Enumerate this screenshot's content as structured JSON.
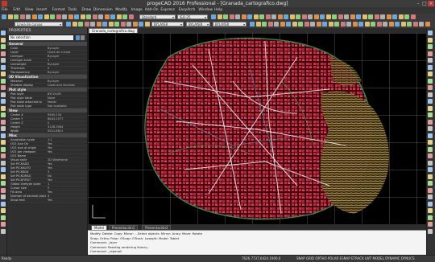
{
  "title": "progeCAD 2016 Professional - [Granada_cartografico.dwg]",
  "menu": [
    "File",
    "Edit",
    "View",
    "Insert",
    "Format",
    "Tools",
    "Draw",
    "Dimension",
    "Modify",
    "Image",
    "Add-On",
    "Express",
    "EasyArch",
    "Window",
    "Help"
  ],
  "toolbar": {
    "style_combo": "Standard",
    "dimstyle_combo": "ISO-25",
    "layer_combo": "Linea de curvas",
    "color_combo": "BYLAYER",
    "linetype_combo": "BYLAYER",
    "lineweight_combo": "BYLAYER"
  },
  "properties": {
    "header": "PROPERTIES",
    "selection": "No selection",
    "sections": {
      "general": "General",
      "viz3d": "3D Visualization",
      "plot": "Plot style",
      "view": "View",
      "misc": "Misc"
    },
    "general_rows": [
      {
        "k": "Color",
        "v": "ByLayer"
      },
      {
        "k": "Layer",
        "v": "Linea de curvas"
      },
      {
        "k": "Linetype",
        "v": "ByLayer"
      },
      {
        "k": "Linetype scale",
        "v": "1"
      },
      {
        "k": "Lineweight",
        "v": "ByLayer"
      },
      {
        "k": "Thickness",
        "v": "0"
      },
      {
        "k": "Transparency",
        "v": "ByLayer"
      }
    ],
    "viz3d_rows": [
      {
        "k": "Material",
        "v": "ByLayer"
      },
      {
        "k": "Shadow display",
        "v": "Casts and receives"
      }
    ],
    "plot_rows": [
      {
        "k": "Plot style",
        "v": "BYCOLOR"
      },
      {
        "k": "Plot style table",
        "v": "None"
      },
      {
        "k": "Plot table attached to",
        "v": "Model"
      },
      {
        "k": "Plot table type",
        "v": "Not available"
      }
    ],
    "view_rows": [
      {
        "k": "Center X",
        "v": "9565.234"
      },
      {
        "k": "Center Y",
        "v": "6843.2577"
      },
      {
        "k": "Center Z",
        "v": "0"
      },
      {
        "k": "Height",
        "v": "3128.3944"
      },
      {
        "k": "Width",
        "v": "5521.8611"
      }
    ],
    "misc_rows": [
      {
        "k": "Annotation scale",
        "v": "1:1"
      },
      {
        "k": "UCS icon On",
        "v": "Yes"
      },
      {
        "k": "UCS icon at origin",
        "v": "Yes"
      },
      {
        "k": "UCS per viewport",
        "v": "Yes"
      },
      {
        "k": "UCS Name",
        "v": ""
      },
      {
        "k": "Visual style",
        "v": "2D Wireframe"
      },
      {
        "k": "Set PICKADD",
        "v": "Yes"
      },
      {
        "k": "Set PICKAUTO",
        "v": "Yes"
      },
      {
        "k": "Set PICKBOX",
        "v": "3"
      },
      {
        "k": "Set PICKDRAG",
        "v": "No"
      },
      {
        "k": "Set PICKFIRST",
        "v": "Yes"
      },
      {
        "k": "Global linetype scale",
        "v": "1"
      },
      {
        "k": "Cursor size",
        "v": "5"
      },
      {
        "k": "Fill area",
        "v": "Yes"
      },
      {
        "k": "Number of decimal places",
        "v": "4"
      },
      {
        "k": "Show text",
        "v": "Yes"
      }
    ]
  },
  "document_tab": "Granada_cartografico.dwg",
  "layout_tabs": [
    "Model",
    "Presentación1",
    "Presentación2"
  ],
  "command_lines": [
    "Modify: Delete: Copy: Mirror: ...Select objects: Mirror: Array: Move: Rotate",
    "Snap: Ortho: Polar: OSnap: OTrack: Lweight: Model: Tablet",
    "Command: _layer",
    "Command: Reading rendering library...",
    "Command: _regenall"
  ],
  "status": {
    "ready": "Ready",
    "coords": "7626.7737,6424.1900,0",
    "modes": "SNAP GRID ORTHO POLAR ESNAP ETRACK LWT MODEL DYNAMIC DYNUCS"
  },
  "colors": {
    "canvas_bg": "#000000",
    "red_fill": "#d42a3e",
    "hill_yellow": "#e6c878",
    "road_white": "#e8e8e8",
    "grid_white": "#cfcfcf"
  }
}
